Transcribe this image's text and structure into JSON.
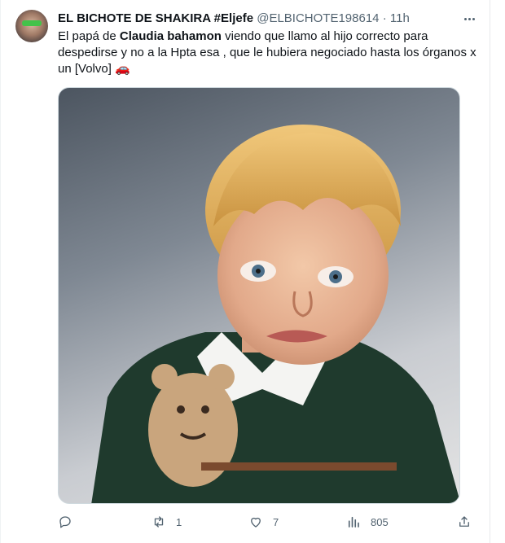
{
  "tweet": {
    "author_name": "EL BICHOTE DE SHAKIRA #Eljefe",
    "handle": "@ELBICHOTE198614",
    "dot": "·",
    "time": "11h",
    "text_part1": "El papá de ",
    "text_bold": "Claudia bahamon",
    "text_part2": " viendo que llamo al hijo correcto para despedirse y no a la Hpta esa , que le hubiera negociado hasta los órganos x un  [Volvo] ",
    "emoji": "🚗"
  },
  "actions": {
    "reply": {
      "icon": "reply-icon",
      "count": ""
    },
    "retweet": {
      "icon": "retweet-icon",
      "count": "1"
    },
    "like": {
      "icon": "heart-icon",
      "count": "7"
    },
    "views": {
      "icon": "views-icon",
      "count": "805"
    },
    "share": {
      "icon": "share-icon",
      "count": ""
    }
  },
  "colors": {
    "text": "#0f1419",
    "secondary": "#536471",
    "border": "#cfd9de"
  }
}
